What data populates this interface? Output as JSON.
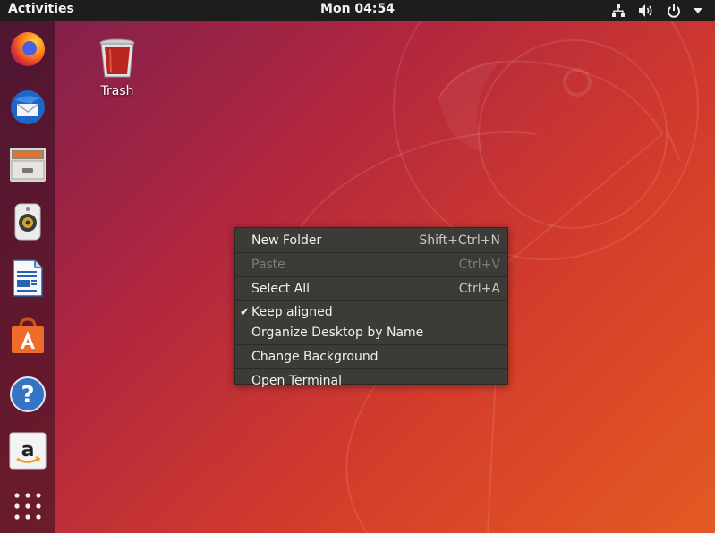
{
  "topbar": {
    "activities_label": "Activities",
    "clock": "Mon 04:54",
    "tray_icons": [
      "network-icon",
      "volume-icon",
      "power-icon",
      "menu-arrow-icon"
    ]
  },
  "dock": {
    "items": [
      {
        "name": "firefox",
        "icon": "firefox-icon"
      },
      {
        "name": "thunderbird",
        "icon": "thunderbird-mail-icon"
      },
      {
        "name": "files",
        "icon": "files-cabinet-icon"
      },
      {
        "name": "rhythmbox",
        "icon": "speaker-icon"
      },
      {
        "name": "libreoffice-writer",
        "icon": "writer-document-icon"
      },
      {
        "name": "ubuntu-software",
        "icon": "software-bag-icon"
      },
      {
        "name": "help",
        "icon": "help-icon"
      },
      {
        "name": "amazon",
        "icon": "amazon-icon"
      },
      {
        "name": "show-applications",
        "icon": "app-grid-icon"
      }
    ]
  },
  "desktop": {
    "trash_label": "Trash"
  },
  "context_menu": {
    "items": [
      {
        "label": "New Folder",
        "shortcut": "Shift+Ctrl+N",
        "enabled": true
      },
      {
        "label": "Paste",
        "shortcut": "Ctrl+V",
        "enabled": false
      },
      {
        "label": "Select All",
        "shortcut": "Ctrl+A",
        "enabled": true
      },
      {
        "label": "Keep aligned",
        "checked": true,
        "enabled": true
      },
      {
        "label": "Organize Desktop by Name",
        "enabled": true
      },
      {
        "label": "Change Background",
        "enabled": true
      },
      {
        "label": "Open Terminal",
        "enabled": true
      }
    ],
    "check_glyph": "✔"
  },
  "colors": {
    "topbar_bg": "#1d1d1b",
    "menu_bg": "#3c3b37",
    "wallpaper_start": "#7a1f4e",
    "wallpaper_end": "#e45a22"
  }
}
